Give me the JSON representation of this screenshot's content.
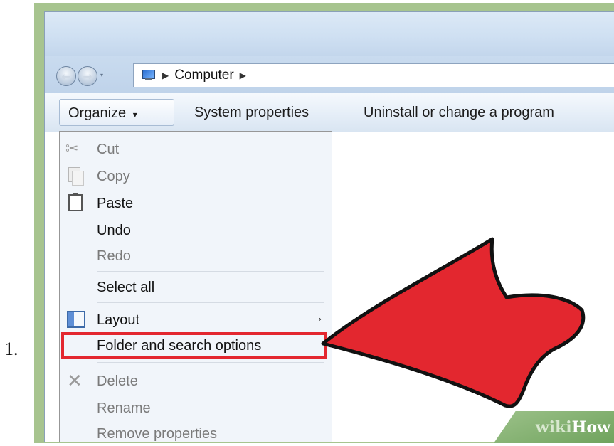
{
  "step": {
    "number": "1."
  },
  "window": {
    "nav": {
      "back_icon": "back-arrow-icon",
      "forward_icon": "forward-arrow-icon"
    },
    "breadcrumb": {
      "items": [
        "Computer"
      ],
      "separator_icon": "triangle-right-icon"
    },
    "toolbar": {
      "organize_label": "Organize",
      "organize_caret": "▾",
      "system_properties_label": "System properties",
      "uninstall_label": "Uninstall or change a program"
    },
    "menu": {
      "items": [
        {
          "label": "Cut",
          "enabled": false,
          "icon": "scissors-icon"
        },
        {
          "label": "Copy",
          "enabled": false,
          "icon": "copy-icon"
        },
        {
          "label": "Paste",
          "enabled": true,
          "icon": "clipboard-icon"
        },
        {
          "label": "Undo",
          "enabled": true
        },
        {
          "label": "Redo",
          "enabled": false
        },
        {
          "label": "Select all",
          "enabled": true
        },
        {
          "label": "Layout",
          "enabled": true,
          "icon": "layout-icon",
          "submenu_arrow": "›"
        },
        {
          "label": "Folder and search options",
          "enabled": true,
          "highlighted": true
        },
        {
          "label": "Delete",
          "enabled": false,
          "icon": "delete-x-icon"
        },
        {
          "label": "Rename",
          "enabled": false
        },
        {
          "label": "Remove properties",
          "enabled": false
        }
      ]
    }
  },
  "annotation": {
    "arrow_color": "#e3272f",
    "highlight_color": "#e3272f"
  },
  "watermark": {
    "wiki": "wiki",
    "how": "How"
  },
  "colors": {
    "frame": "#a7c48f",
    "menu_bg": "#f1f5fa"
  }
}
